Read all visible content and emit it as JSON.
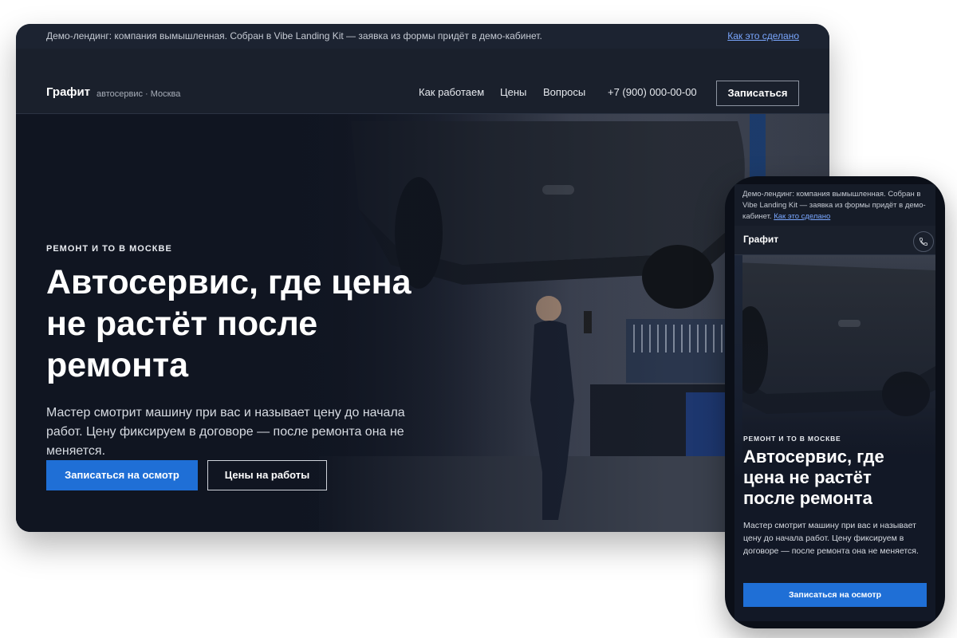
{
  "desktop": {
    "banner": {
      "text": "Демо-лендинг: компания вымышленная. Собран в Vibe Landing Kit — заявка из формы придёт в демо-кабинет.",
      "link": "Как это сделано"
    },
    "nav": {
      "logo": "Графит",
      "subtitle": "автосервис · Москва",
      "links": [
        "Как работаем",
        "Цены",
        "Вопросы"
      ],
      "phone": "+7 (900) 000-00-00",
      "cta": "Записаться"
    },
    "hero": {
      "kicker": "РЕМОНТ И ТО В МОСКВЕ",
      "title": "Автосервис, где цена не растёт после ремонта",
      "text": "Мастер смотрит машину при вас и называет цену до начала работ. Цену фиксируем в договоре — после ремонта она не меняется.",
      "primary_button": "Записаться на осмотр",
      "secondary_button": "Цены на работы"
    }
  },
  "mobile": {
    "banner_text": "Демо-лендинг: компания вымышленная. Собран в Vibe Landing Kit — заявка из формы придёт в демо-кабинет.",
    "banner_link": "Как это сделано",
    "logo": "Графит",
    "call_icon": "phone-icon",
    "kicker": "РЕМОНТ И ТО В МОСКВЕ",
    "title": "Автосервис, где цена не растёт после ремонта",
    "text": "Мастер смотрит машину при вас и называет цену до начала работ. Цену фиксируем в договоре — после ремонта она не меняется.",
    "button": "Записаться на осмотр"
  },
  "colors": {
    "accent": "#1f6fd6",
    "background": "#121826",
    "link": "#7aa7ff"
  }
}
